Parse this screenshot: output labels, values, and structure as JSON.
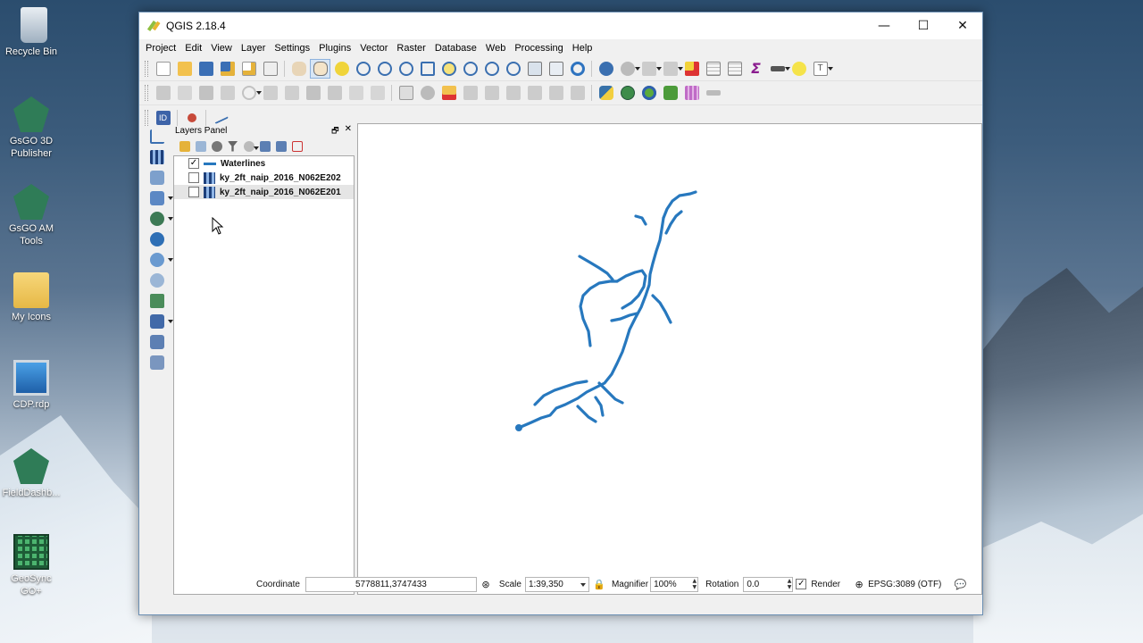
{
  "desktop": {
    "icons": [
      {
        "label": "Recycle Bin",
        "icon": "recycle-bin-icon"
      },
      {
        "label": "GsGO 3D Publisher",
        "icon": "gsgo-icon"
      },
      {
        "label": "GsGO AM Tools",
        "icon": "gsgo-icon"
      },
      {
        "label": "My Icons",
        "icon": "folder-icon"
      },
      {
        "label": "CDP.rdp",
        "icon": "remote-desktop-icon"
      },
      {
        "label": "FieldDashb...",
        "icon": "gsgo-icon"
      },
      {
        "label": "GeoSync GO+",
        "icon": "grid-app-icon"
      }
    ]
  },
  "window": {
    "title": "QGIS 2.18.4",
    "controls": {
      "minimize": "—",
      "maximize": "☐",
      "close": "✕"
    }
  },
  "menu": [
    "Project",
    "Edit",
    "View",
    "Layer",
    "Settings",
    "Plugins",
    "Vector",
    "Raster",
    "Database",
    "Web",
    "Processing",
    "Help"
  ],
  "layers_panel": {
    "title": "Layers Panel",
    "float_glyph": "🗗",
    "close_glyph": "✕",
    "layers": [
      {
        "name": "Waterlines",
        "checked": true,
        "type": "line",
        "check_mark": "✓"
      },
      {
        "name": "ky_2ft_naip_2016_N062E202",
        "checked": false,
        "type": "raster",
        "check_mark": ""
      },
      {
        "name": "ky_2ft_naip_2016_N062E201",
        "checked": false,
        "type": "raster",
        "check_mark": "",
        "selected": true
      }
    ]
  },
  "map": {
    "line_color": "#2778be",
    "background": "#ffffff"
  },
  "statusbar": {
    "coordinate_label": "Coordinate",
    "coordinate_value": "5778811,3747433",
    "scale_label": "Scale",
    "scale_value": "1:39,350",
    "magnifier_label": "Magnifier",
    "magnifier_value": "100%",
    "rotation_label": "Rotation",
    "rotation_value": "0.0",
    "render_label": "Render",
    "render_checked": "✓",
    "crs": "EPSG:3089 (OTF)"
  }
}
